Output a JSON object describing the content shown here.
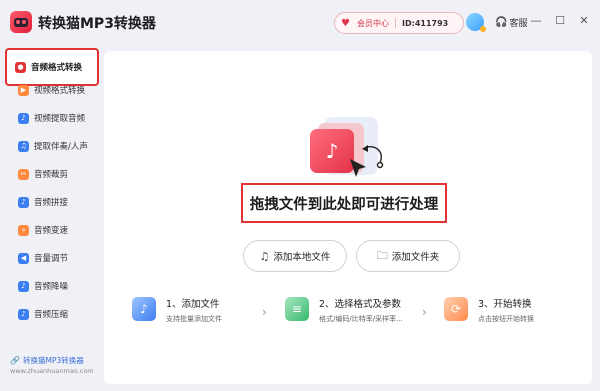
{
  "app": {
    "title": "转换猫MP3转换器",
    "brand_color": "#e33148"
  },
  "header": {
    "vip_label": "会员中心",
    "user_id": "ID:411793",
    "support_label": "客服",
    "window_buttons": [
      "minimize-icon",
      "maximize-icon",
      "close-icon"
    ]
  },
  "sidebar": {
    "items": [
      {
        "label": "音频格式转换",
        "icon": "audio-convert-icon",
        "color": "#e03434",
        "active": true
      },
      {
        "label": "视频格式转换",
        "icon": "video-convert-icon",
        "color": "#ff8a3d"
      },
      {
        "label": "视频提取音频",
        "icon": "video-extract-icon",
        "color": "#3c7df0"
      },
      {
        "label": "提取伴奏/人声",
        "icon": "vocal-extract-icon",
        "color": "#3c7df0"
      },
      {
        "label": "音频裁剪",
        "icon": "audio-cut-icon",
        "color": "#ff8a3d"
      },
      {
        "label": "音频拼接",
        "icon": "audio-merge-icon",
        "color": "#3c7df0"
      },
      {
        "label": "音频变速",
        "icon": "audio-speed-icon",
        "color": "#ff8a3d"
      },
      {
        "label": "音量调节",
        "icon": "volume-icon",
        "color": "#3c7df0"
      },
      {
        "label": "音频降噪",
        "icon": "denoise-icon",
        "color": "#3c7df0"
      },
      {
        "label": "音频压缩",
        "icon": "compress-icon",
        "color": "#3c7df0"
      }
    ],
    "footer_link": "转换猫MP3转换器",
    "footer_url": "www.zhuanhuanmao.com"
  },
  "main": {
    "drop_text": "拖拽文件到此处即可进行处理",
    "add_local_label": "添加本地文件",
    "add_folder_label": "添加文件夹",
    "steps": [
      {
        "title": "1、添加文件",
        "desc": "支持批量添加文件"
      },
      {
        "title": "2、选择格式及参数",
        "desc": "格式/编码/比特率/采样率..."
      },
      {
        "title": "3、开始转换",
        "desc": "点击按钮开始转换"
      }
    ]
  }
}
